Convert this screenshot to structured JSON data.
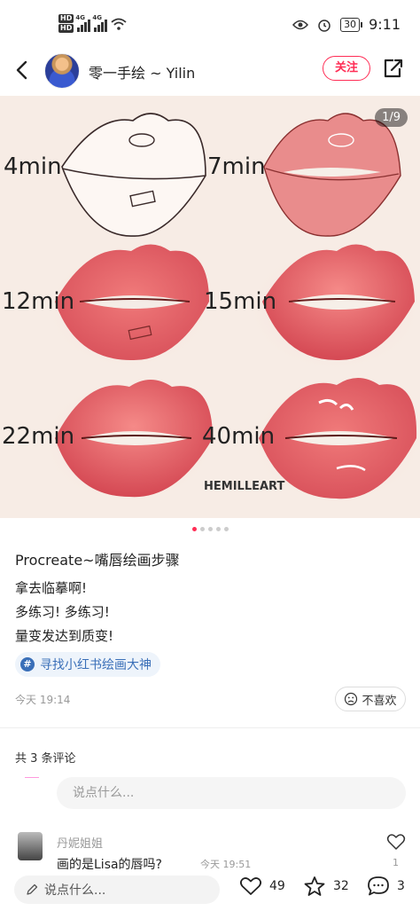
{
  "status_bar": {
    "net1": "HD",
    "net2": "HD",
    "sig1": "4G",
    "sig2": "4G",
    "battery": "30",
    "time": "9:11"
  },
  "header": {
    "user_name": "零一手绘 ~ Yilin",
    "follow_label": "关注"
  },
  "image": {
    "counter": "1/9",
    "labels": [
      "4min",
      "7min",
      "12min",
      "15min",
      "22min",
      "40min"
    ],
    "watermark": "HEMILLEART"
  },
  "pager": {
    "count": 5,
    "active": 0
  },
  "post": {
    "title": "Procreate~嘴唇绘画步骤",
    "lines": [
      "拿去临摹啊!",
      "多练习! 多练习!",
      "量变发达到质变!"
    ],
    "tag": "寻找小红书绘画大神",
    "date": "今天 19:14",
    "dislike_label": "不喜欢"
  },
  "comments": {
    "count_label": "共 3 条评论",
    "input_placeholder": "说点什么...",
    "items": [
      {
        "name": "丹妮姐姐",
        "text": "画的是Lisa的唇吗?",
        "time": "今天 19:51",
        "likes": "1"
      }
    ]
  },
  "bottom_bar": {
    "input_label": "说点什么...",
    "likes": "49",
    "favorites": "32",
    "comments": "3"
  },
  "colors": {
    "accent": "#ff2d55",
    "link": "#3a6fb8"
  }
}
